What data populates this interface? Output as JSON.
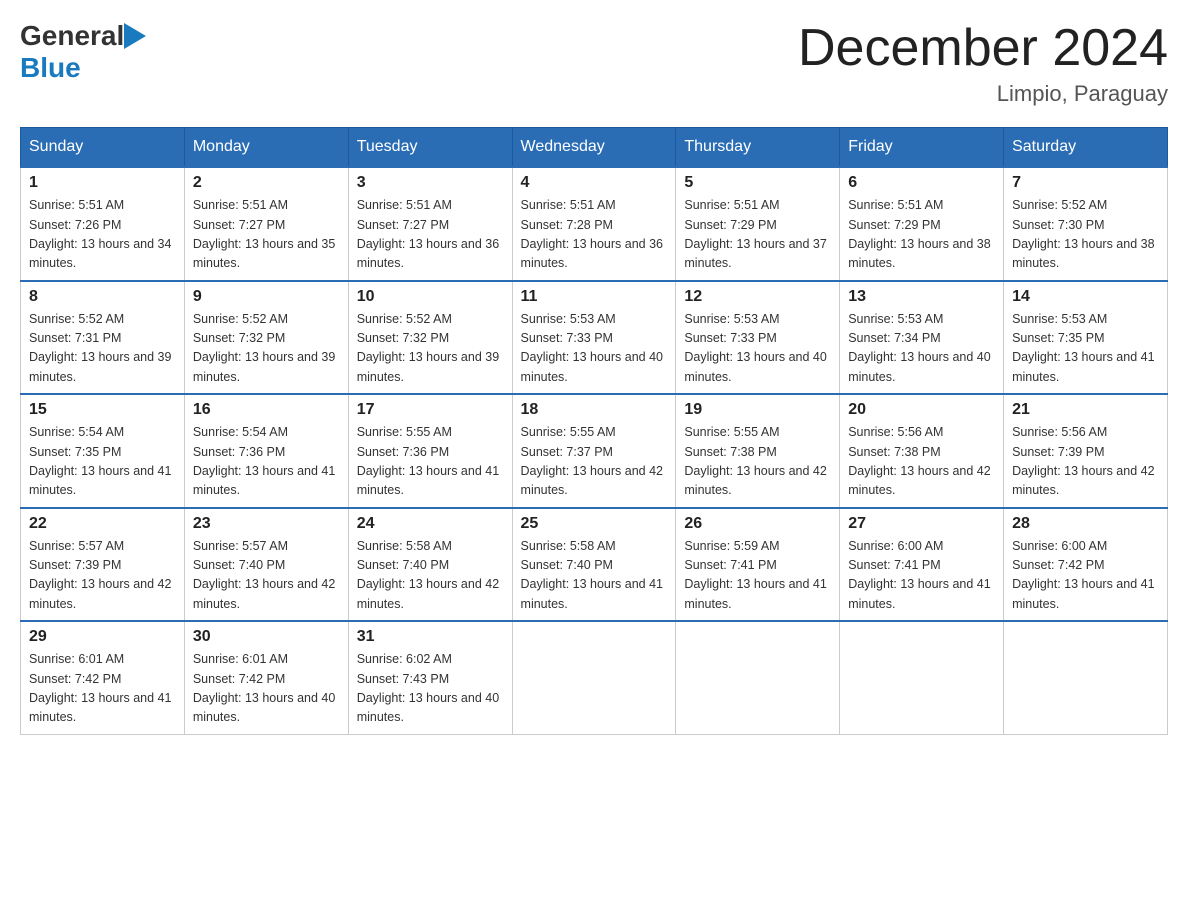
{
  "header": {
    "logo_general": "General",
    "logo_blue": "Blue",
    "title": "December 2024",
    "subtitle": "Limpio, Paraguay"
  },
  "days_of_week": [
    "Sunday",
    "Monday",
    "Tuesday",
    "Wednesday",
    "Thursday",
    "Friday",
    "Saturday"
  ],
  "weeks": [
    [
      {
        "day": "1",
        "sunrise": "5:51 AM",
        "sunset": "7:26 PM",
        "daylight": "13 hours and 34 minutes."
      },
      {
        "day": "2",
        "sunrise": "5:51 AM",
        "sunset": "7:27 PM",
        "daylight": "13 hours and 35 minutes."
      },
      {
        "day": "3",
        "sunrise": "5:51 AM",
        "sunset": "7:27 PM",
        "daylight": "13 hours and 36 minutes."
      },
      {
        "day": "4",
        "sunrise": "5:51 AM",
        "sunset": "7:28 PM",
        "daylight": "13 hours and 36 minutes."
      },
      {
        "day": "5",
        "sunrise": "5:51 AM",
        "sunset": "7:29 PM",
        "daylight": "13 hours and 37 minutes."
      },
      {
        "day": "6",
        "sunrise": "5:51 AM",
        "sunset": "7:29 PM",
        "daylight": "13 hours and 38 minutes."
      },
      {
        "day": "7",
        "sunrise": "5:52 AM",
        "sunset": "7:30 PM",
        "daylight": "13 hours and 38 minutes."
      }
    ],
    [
      {
        "day": "8",
        "sunrise": "5:52 AM",
        "sunset": "7:31 PM",
        "daylight": "13 hours and 39 minutes."
      },
      {
        "day": "9",
        "sunrise": "5:52 AM",
        "sunset": "7:32 PM",
        "daylight": "13 hours and 39 minutes."
      },
      {
        "day": "10",
        "sunrise": "5:52 AM",
        "sunset": "7:32 PM",
        "daylight": "13 hours and 39 minutes."
      },
      {
        "day": "11",
        "sunrise": "5:53 AM",
        "sunset": "7:33 PM",
        "daylight": "13 hours and 40 minutes."
      },
      {
        "day": "12",
        "sunrise": "5:53 AM",
        "sunset": "7:33 PM",
        "daylight": "13 hours and 40 minutes."
      },
      {
        "day": "13",
        "sunrise": "5:53 AM",
        "sunset": "7:34 PM",
        "daylight": "13 hours and 40 minutes."
      },
      {
        "day": "14",
        "sunrise": "5:53 AM",
        "sunset": "7:35 PM",
        "daylight": "13 hours and 41 minutes."
      }
    ],
    [
      {
        "day": "15",
        "sunrise": "5:54 AM",
        "sunset": "7:35 PM",
        "daylight": "13 hours and 41 minutes."
      },
      {
        "day": "16",
        "sunrise": "5:54 AM",
        "sunset": "7:36 PM",
        "daylight": "13 hours and 41 minutes."
      },
      {
        "day": "17",
        "sunrise": "5:55 AM",
        "sunset": "7:36 PM",
        "daylight": "13 hours and 41 minutes."
      },
      {
        "day": "18",
        "sunrise": "5:55 AM",
        "sunset": "7:37 PM",
        "daylight": "13 hours and 42 minutes."
      },
      {
        "day": "19",
        "sunrise": "5:55 AM",
        "sunset": "7:38 PM",
        "daylight": "13 hours and 42 minutes."
      },
      {
        "day": "20",
        "sunrise": "5:56 AM",
        "sunset": "7:38 PM",
        "daylight": "13 hours and 42 minutes."
      },
      {
        "day": "21",
        "sunrise": "5:56 AM",
        "sunset": "7:39 PM",
        "daylight": "13 hours and 42 minutes."
      }
    ],
    [
      {
        "day": "22",
        "sunrise": "5:57 AM",
        "sunset": "7:39 PM",
        "daylight": "13 hours and 42 minutes."
      },
      {
        "day": "23",
        "sunrise": "5:57 AM",
        "sunset": "7:40 PM",
        "daylight": "13 hours and 42 minutes."
      },
      {
        "day": "24",
        "sunrise": "5:58 AM",
        "sunset": "7:40 PM",
        "daylight": "13 hours and 42 minutes."
      },
      {
        "day": "25",
        "sunrise": "5:58 AM",
        "sunset": "7:40 PM",
        "daylight": "13 hours and 41 minutes."
      },
      {
        "day": "26",
        "sunrise": "5:59 AM",
        "sunset": "7:41 PM",
        "daylight": "13 hours and 41 minutes."
      },
      {
        "day": "27",
        "sunrise": "6:00 AM",
        "sunset": "7:41 PM",
        "daylight": "13 hours and 41 minutes."
      },
      {
        "day": "28",
        "sunrise": "6:00 AM",
        "sunset": "7:42 PM",
        "daylight": "13 hours and 41 minutes."
      }
    ],
    [
      {
        "day": "29",
        "sunrise": "6:01 AM",
        "sunset": "7:42 PM",
        "daylight": "13 hours and 41 minutes."
      },
      {
        "day": "30",
        "sunrise": "6:01 AM",
        "sunset": "7:42 PM",
        "daylight": "13 hours and 40 minutes."
      },
      {
        "day": "31",
        "sunrise": "6:02 AM",
        "sunset": "7:43 PM",
        "daylight": "13 hours and 40 minutes."
      },
      null,
      null,
      null,
      null
    ]
  ],
  "cell_labels": {
    "sunrise": "Sunrise:",
    "sunset": "Sunset:",
    "daylight": "Daylight:"
  }
}
